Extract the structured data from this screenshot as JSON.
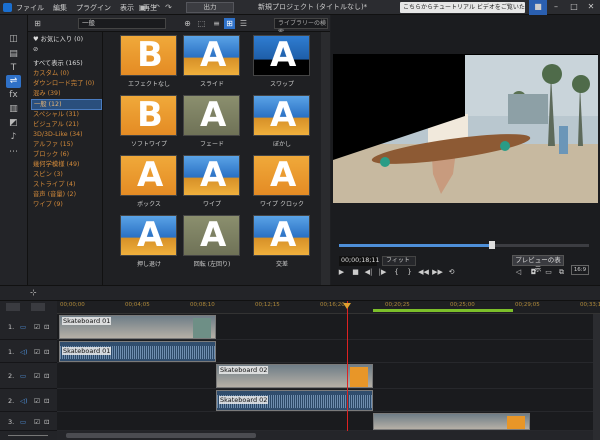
{
  "menu": [
    "ファイル",
    "編集",
    "プラグイン",
    "表示",
    "再生"
  ],
  "export_label": "出力",
  "window_title": "新規プロジェクト (タイトルなし)*",
  "tip_text": "こちらからチュートリアル ビデオをご覧いただけます。",
  "library": {
    "filter": "一般",
    "search_placeholder": "ライブラリーの検索",
    "favorites": "お気に入り (0)",
    "categories": [
      {
        "label": "すべて表示 (165)",
        "style": "white"
      },
      {
        "label": "カスタム (0)"
      },
      {
        "label": "ダウンロード完了 (0)"
      },
      {
        "label": "混み (39)"
      },
      {
        "label": "一般 (12)",
        "selected": true
      },
      {
        "label": "スペシャル (31)"
      },
      {
        "label": "ビジュアル (21)"
      },
      {
        "label": "3D/3D-Like (34)"
      },
      {
        "label": "アルファ (15)"
      },
      {
        "label": "ブロック (6)"
      },
      {
        "label": "幾何学模様 (49)"
      },
      {
        "label": "スピン (3)"
      },
      {
        "label": "ストライプ (4)"
      },
      {
        "label": "音声 (音量) (2)"
      },
      {
        "label": "ワイプ (9)"
      }
    ],
    "transitions": [
      {
        "label": "エフェクトなし",
        "letter": "B",
        "style": "tB"
      },
      {
        "label": "スライド",
        "letter": "A",
        "style": "tA"
      },
      {
        "label": "スワップ",
        "letter": "A",
        "style": "tdark"
      },
      {
        "label": "ソフトワイプ",
        "letter": "B",
        "style": "tB"
      },
      {
        "label": "フェード",
        "letter": "A",
        "style": "tsepia"
      },
      {
        "label": "ぼかし",
        "letter": "A",
        "style": "tA"
      },
      {
        "label": "ボックス",
        "letter": "A",
        "style": "tB"
      },
      {
        "label": "ワイプ",
        "letter": "A",
        "style": "tA"
      },
      {
        "label": "ワイプ クロック",
        "letter": "A",
        "style": "tB"
      },
      {
        "label": "押し退け",
        "letter": "A",
        "style": "tA"
      },
      {
        "label": "回転 (左回り)",
        "letter": "A",
        "style": "tsepia"
      },
      {
        "label": "交差",
        "letter": "A",
        "style": "tA"
      }
    ]
  },
  "preview": {
    "timecode": "00;00;18;11",
    "fit": "フィット",
    "preview_button": "プレビューの表示",
    "quality": "16:9",
    "progress": 0.61
  },
  "ruler_ticks": [
    "00;00;00",
    "00;04;05",
    "00;08;10",
    "00;12;15",
    "00;16;20",
    "00;20;25",
    "00;25;00",
    "00;29;05",
    "00;33;10"
  ],
  "tracks": [
    {
      "label": "1.",
      "clips": [
        {
          "name": "Skateboard 01",
          "type": "video"
        },
        {
          "name": "Skateboard 01",
          "type": "audio"
        }
      ]
    },
    {
      "label": "2.",
      "clips": [
        {
          "name": "Skateboard 02",
          "type": "video"
        },
        {
          "name": "Skateboard 02",
          "type": "audio"
        }
      ]
    },
    {
      "label": "3.",
      "clips": [
        {
          "name": "",
          "type": "video"
        }
      ]
    }
  ]
}
